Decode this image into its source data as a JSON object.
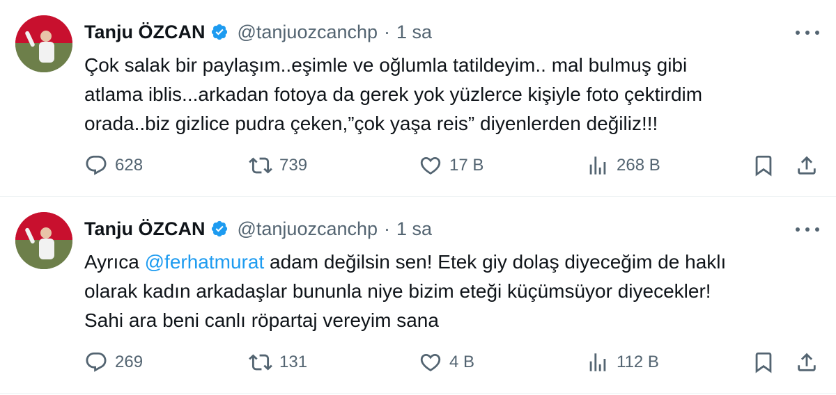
{
  "colors": {
    "text": "#0f1419",
    "secondary": "#536471",
    "link": "#1d9bf0",
    "verified": "#1d9bf0",
    "divider": "#eff3f4"
  },
  "icons": {
    "reply": "reply-icon",
    "repost": "repost-icon",
    "like": "like-icon",
    "views": "views-icon",
    "bookmark": "bookmark-icon",
    "share": "share-icon",
    "more": "more-icon",
    "verified": "verified-badge-icon"
  },
  "tweets": [
    {
      "author_name": "Tanju ÖZCAN",
      "handle": "@tanjuozcanchp",
      "separator": "·",
      "time": "1 sa",
      "text_lines": [
        "Çok salak bir paylaşım..eşimle ve oğlumla tatildeyim.. mal bulmuş gibi",
        "atlama iblis...arkadan fotoya da gerek yok yüzlerce kişiyle foto çektirdim",
        "orada..biz gizlice pudra çeken,”çok yaşa reis” diyenlerden değiliz!!!"
      ],
      "replies": "628",
      "reposts": "739",
      "likes": "17 B",
      "views": "268 B"
    },
    {
      "author_name": "Tanju ÖZCAN",
      "handle": "@tanjuozcanchp",
      "separator": "·",
      "time": "1 sa",
      "text_line1_prefix": "Ayrıca ",
      "text_line1_mention": "@ferhatmurat",
      "text_line1_suffix": " adam değilsin sen! Etek giy dolaş diyeceğim de haklı",
      "text_lines": [
        "olarak kadın arkadaşlar bununla niye bizim eteği küçümsüyor diyecekler!",
        "Sahi ara beni canlı röpartaj vereyim sana"
      ],
      "replies": "269",
      "reposts": "131",
      "likes": "4 B",
      "views": "112 B"
    }
  ]
}
